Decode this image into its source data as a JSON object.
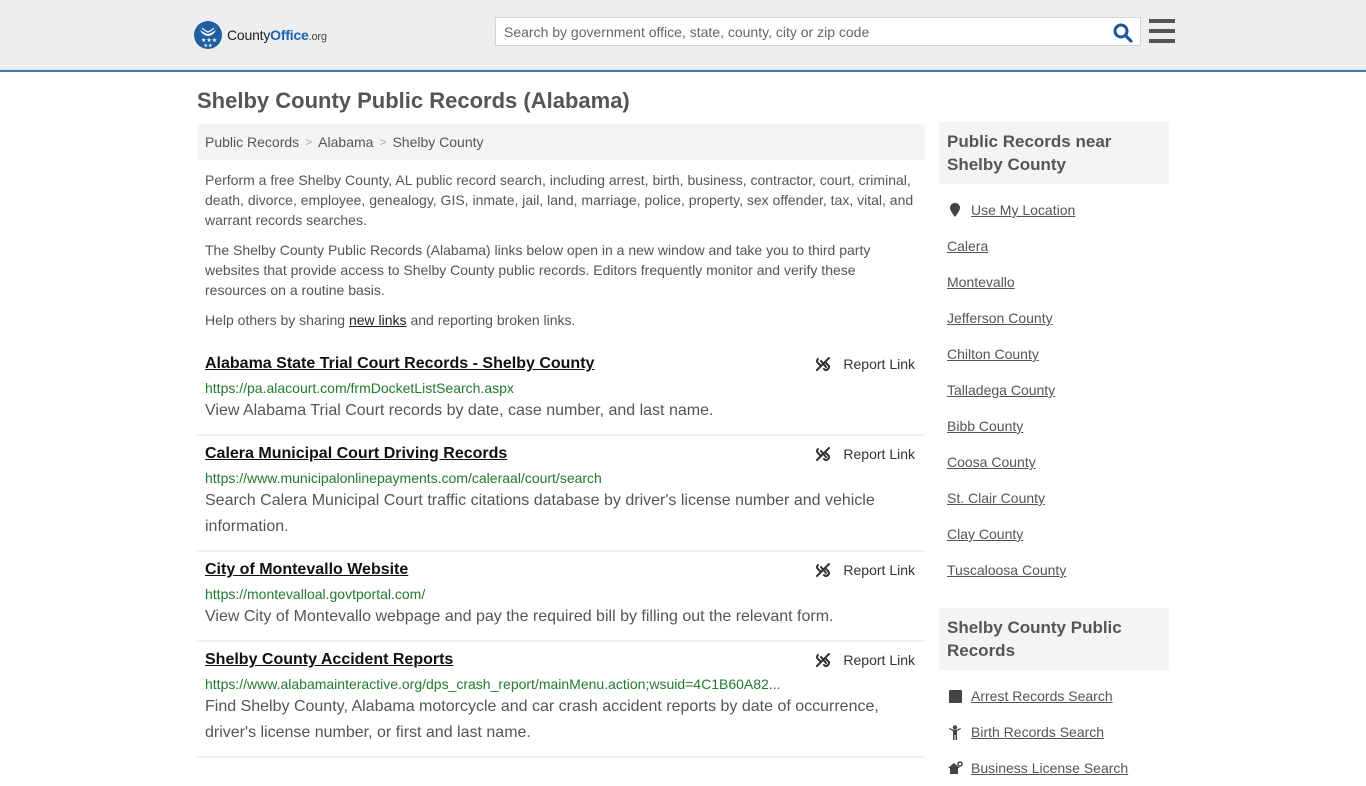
{
  "header": {
    "logo": {
      "name": "County",
      "name_highlight": "Office",
      "tld": ".org"
    },
    "search": {
      "placeholder": "Search by government office, state, county, city or zip code",
      "value": ""
    },
    "colors": {
      "brand": "#1f5fa0",
      "accent_border": "#3a7bb0"
    }
  },
  "page": {
    "title": "Shelby County Public Records (Alabama)",
    "breadcrumb": [
      "Public Records",
      "Alabama",
      "Shelby County"
    ],
    "intro": [
      "Perform a free Shelby County, AL public record search, including arrest, birth, business, contractor, court, criminal, death, divorce, employee, genealogy, GIS, inmate, jail, land, marriage, police, property, sex offender, tax, vital, and warrant records searches.",
      "The Shelby County Public Records (Alabama) links below open in a new window and take you to third party websites that provide access to Shelby County public records. Editors frequently monitor and verify these resources on a routine basis."
    ],
    "help": {
      "before": "Help others by sharing ",
      "link": "new links",
      "after": " and reporting broken links."
    },
    "report_label": "Report Link",
    "records": [
      {
        "title": "Alabama State Trial Court Records - Shelby County",
        "url": "https://pa.alacourt.com/frmDocketListSearch.aspx",
        "description": "View Alabama Trial Court records by date, case number, and last name."
      },
      {
        "title": "Calera Municipal Court Driving Records",
        "url": "https://www.municipalonlinepayments.com/caleraal/court/search",
        "description": "Search Calera Municipal Court traffic citations database by driver's license number and vehicle information."
      },
      {
        "title": "City of Montevallo Website",
        "url": "https://montevalloal.govtportal.com/",
        "description": "View City of Montevallo webpage and pay the required bill by filling out the relevant form."
      },
      {
        "title": "Shelby County Accident Reports",
        "url": "https://www.alabamainteractive.org/dps_crash_report/mainMenu.action;wsuid=4C1B60A82...",
        "description": "Find Shelby County, Alabama motorcycle and car crash accident reports by date of occurrence, driver's license number, or first and last name."
      }
    ]
  },
  "sidebar": {
    "nearby": {
      "heading": "Public Records near Shelby County",
      "use_location": "Use My Location",
      "items": [
        "Calera",
        "Montevallo",
        "Jefferson County",
        "Chilton County",
        "Talladega County",
        "Bibb County",
        "Coosa County",
        "St. Clair County",
        "Clay County",
        "Tuscaloosa County"
      ]
    },
    "records": {
      "heading": "Shelby County Public Records",
      "items": [
        {
          "label": "Arrest Records Search",
          "icon": "arrest-icon"
        },
        {
          "label": "Birth Records Search",
          "icon": "child-icon"
        },
        {
          "label": "Business License Search",
          "icon": "business-icon"
        }
      ]
    }
  }
}
